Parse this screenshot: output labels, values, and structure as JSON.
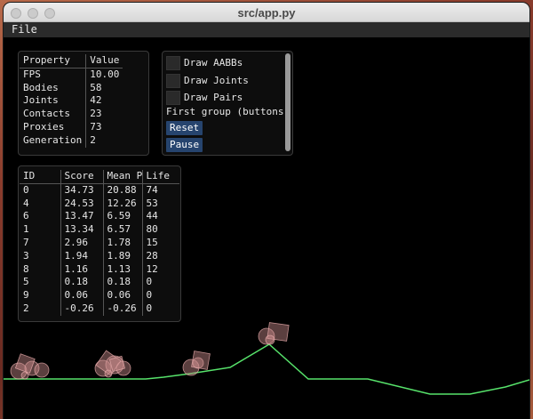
{
  "window": {
    "title": "src/app.py"
  },
  "menu": {
    "file_label": "File"
  },
  "properties": {
    "headers": [
      "Property",
      "Value"
    ],
    "rows": [
      [
        "FPS",
        "10.00"
      ],
      [
        "Bodies",
        "58"
      ],
      [
        "Joints",
        "42"
      ],
      [
        "Contacts",
        "23"
      ],
      [
        "Proxies",
        "73"
      ],
      [
        "Generation",
        "2"
      ]
    ]
  },
  "controls": {
    "checkboxes": [
      "Draw AABBs",
      "Draw Joints",
      "Draw Pairs"
    ],
    "group_label": "First group (buttons)",
    "reset_label": "Reset",
    "pause_label": "Pause"
  },
  "scores": {
    "headers": [
      "ID",
      "Score",
      "Mean Po",
      "Life"
    ],
    "rows": [
      [
        "0",
        "34.73",
        "20.88",
        "74"
      ],
      [
        "4",
        "24.53",
        "12.26",
        "53"
      ],
      [
        "6",
        "13.47",
        "6.59",
        "44"
      ],
      [
        "1",
        "13.34",
        "6.57",
        "80"
      ],
      [
        "7",
        "2.96",
        "1.78",
        "15"
      ],
      [
        "3",
        "1.94",
        "1.89",
        "28"
      ],
      [
        "8",
        "1.16",
        "1.13",
        "12"
      ],
      [
        "5",
        "0.18",
        "0.18",
        "0"
      ],
      [
        "9",
        "0.06",
        "0.06",
        "0"
      ],
      [
        "2",
        "-0.26",
        "-0.26",
        "0"
      ]
    ]
  },
  "colors": {
    "terrain": "#57e36b",
    "creature": "#c98c8c",
    "button": "#26446e"
  }
}
